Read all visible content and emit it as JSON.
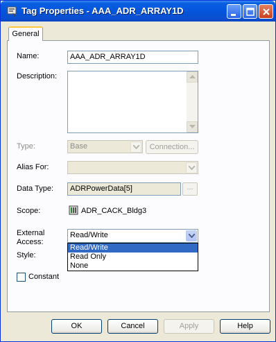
{
  "window": {
    "title": "Tag Properties - AAA_ADR_ARRAY1D"
  },
  "tabs": [
    {
      "label": "General"
    }
  ],
  "form": {
    "name": {
      "label": "Name:",
      "value": "AAA_ADR_ARRAY1D"
    },
    "description": {
      "label": "Description:",
      "value": ""
    },
    "type": {
      "label": "Type:",
      "value": "Base",
      "button": "Connection..."
    },
    "alias_for": {
      "label": "Alias For:",
      "value": ""
    },
    "data_type": {
      "label": "Data Type:",
      "value": "ADRPowerData[5]",
      "button": "..."
    },
    "scope": {
      "label": "Scope:",
      "value": "ADR_CACK_Bldg3",
      "icon": "controller-icon"
    },
    "external_access": {
      "label_line1": "External",
      "label_line2": "Access:",
      "value": "Read/Write",
      "options": [
        "Read/Write",
        "Read Only",
        "None"
      ],
      "selected_index": 0
    },
    "style": {
      "label": "Style:"
    },
    "constant": {
      "label": "Constant",
      "checked": false
    }
  },
  "buttons": {
    "ok": "OK",
    "cancel": "Cancel",
    "apply": "Apply",
    "help": "Help"
  }
}
